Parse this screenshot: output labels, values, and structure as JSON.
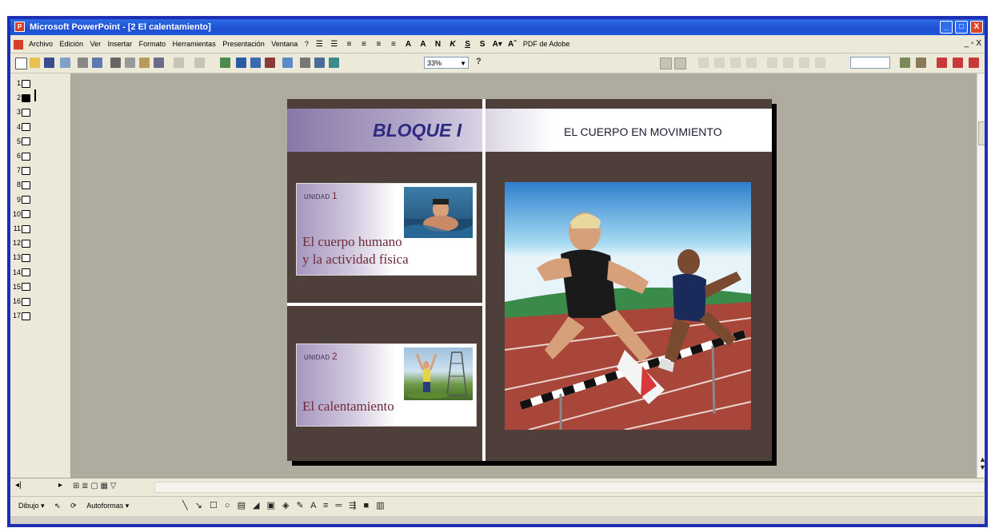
{
  "window": {
    "title": "Microsoft PowerPoint - [2 El calentamiento]",
    "controls": [
      "_",
      "□",
      "X"
    ]
  },
  "menu": {
    "items": [
      "Archivo",
      "Edición",
      "Ver",
      "Insertar",
      "Formato",
      "Herramientas",
      "Presentación",
      "Ventana",
      "?"
    ],
    "format_buttons": [
      "A",
      "A",
      "N",
      "K",
      "S",
      "S"
    ],
    "pdf_label": "PDF de Adobe",
    "doc_controls": "_ ▫ X"
  },
  "toolbar": {
    "zoom": "33%",
    "help_icon": "?"
  },
  "outline": {
    "slides": [
      "1",
      "2",
      "3",
      "4",
      "5",
      "6",
      "7",
      "8",
      "9",
      "10",
      "11",
      "12",
      "13",
      "14",
      "15",
      "16",
      "17"
    ],
    "active_index": 1
  },
  "slide": {
    "block_title": "BLOQUE I",
    "block_subtitle": "EL CUERPO  EN MOVIMIENTO",
    "units": [
      {
        "label": "UNIDAD",
        "number": "1",
        "title_line1": "El cuerpo humano",
        "title_line2": "y la actividad física",
        "photo_icon": "swimmer-photo"
      },
      {
        "label": "UNIDAD",
        "number": "2",
        "title_line1": "El calentamiento",
        "title_line2": "",
        "photo_icon": "warmup-photo"
      }
    ],
    "main_photo_icon": "hurdles-photo"
  },
  "drawbar": {
    "dibujo_label": "Dibujo ▾",
    "autoformas_label": "Autoformas ▾"
  },
  "colors": {
    "titlebar": "#1f4fd2",
    "slide_background": "#4f3f3a",
    "block_title": "#2d2a80",
    "unit_title": "#6e2a3a"
  }
}
